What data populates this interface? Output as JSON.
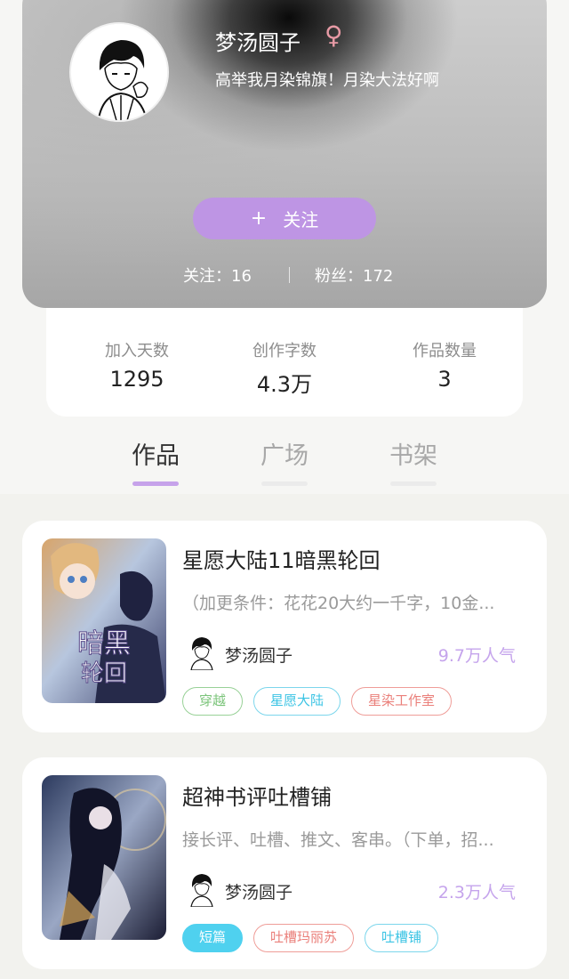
{
  "profile": {
    "name": "梦汤圆子",
    "gender_icon": "♀",
    "bio": "高举我月染锦旗！月染大法好啊",
    "follow_plus": "+",
    "follow_label": "关注",
    "following_text": "关注：16",
    "fans_text": "粉丝：172"
  },
  "counts": [
    {
      "label": "加入天数",
      "value": "1295"
    },
    {
      "label": "创作字数",
      "value": "4.3万"
    },
    {
      "label": "作品数量",
      "value": "3"
    }
  ],
  "tabs": [
    {
      "label": "作品",
      "active": true
    },
    {
      "label": "广场",
      "active": false
    },
    {
      "label": "书架",
      "active": false
    }
  ],
  "works": [
    {
      "title": "星愿大陆11暗黑轮回",
      "description": "（加更条件：花花20大约一千字，10金...",
      "author": "梦汤圆子",
      "popularity": "9.7万人气",
      "tags": [
        {
          "label": "穿越",
          "style": "green"
        },
        {
          "label": "星愿大陆",
          "style": "blue"
        },
        {
          "label": "星染工作室",
          "style": "red"
        }
      ]
    },
    {
      "title": "超神书评吐槽铺",
      "description": "接长评、吐槽、推文、客串。（下单，招...",
      "author": "梦汤圆子",
      "popularity": "2.3万人气",
      "tags": [
        {
          "label": "短篇",
          "style": "solid-blue"
        },
        {
          "label": "吐槽玛丽苏",
          "style": "red"
        },
        {
          "label": "吐槽铺",
          "style": "blue"
        }
      ]
    }
  ],
  "colors": {
    "accent": "#be95e4",
    "popularity": "#c5a4ec"
  }
}
